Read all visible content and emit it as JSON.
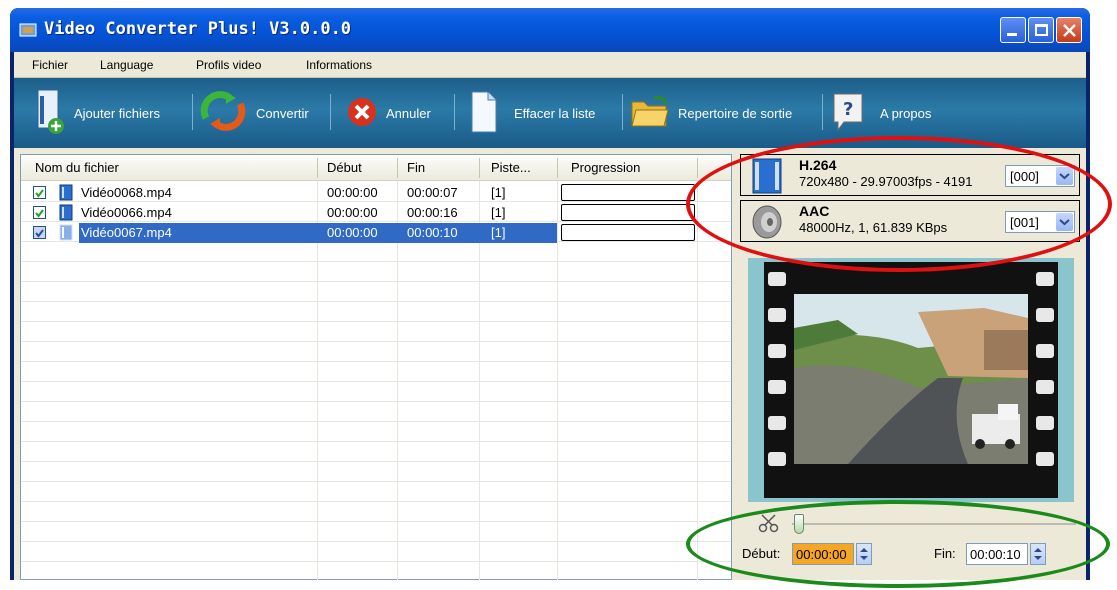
{
  "window": {
    "title": "Video Converter Plus! V3.0.0.0"
  },
  "menu": [
    "Fichier",
    "Language",
    "Profils video",
    "Informations"
  ],
  "toolbar": {
    "add_files": "Ajouter fichiers",
    "convert": "Convertir",
    "cancel": "Annuler",
    "clear_list": "Effacer la liste",
    "output_dir": "Repertoire de sortie",
    "about": "A propos"
  },
  "file_list": {
    "columns": [
      "Nom du fichier",
      "Début",
      "Fin",
      "Piste...",
      "Progression"
    ],
    "rows": [
      {
        "name": "Vidéo0068.mp4",
        "start": "00:00:00",
        "end": "00:00:07",
        "track": "[1]",
        "checked": true,
        "selected": false
      },
      {
        "name": "Vidéo0066.mp4",
        "start": "00:00:00",
        "end": "00:00:16",
        "track": "[1]",
        "checked": true,
        "selected": false
      },
      {
        "name": "Vidéo0067.mp4",
        "start": "00:00:00",
        "end": "00:00:10",
        "track": "[1]",
        "checked": true,
        "selected": true
      }
    ]
  },
  "video_stream": {
    "codec": "H.264",
    "info": "720x480 - 29.97003fps - 4191",
    "track": "[000]"
  },
  "audio_stream": {
    "codec": "AAC",
    "info": "48000Hz, 1, 61.839 KBps",
    "track": "[001]"
  },
  "trim": {
    "start_label": "Début:",
    "start_value": "00:00:00",
    "end_label": "Fin:",
    "end_value": "00:00:10"
  },
  "colors": {
    "titlebar": "#0552d6",
    "toolbar": "#2b7aa8",
    "selection": "#316ac5",
    "start_highlight": "#f5a623",
    "annotation_red": "#e01010",
    "annotation_green": "#1a8a1a"
  }
}
